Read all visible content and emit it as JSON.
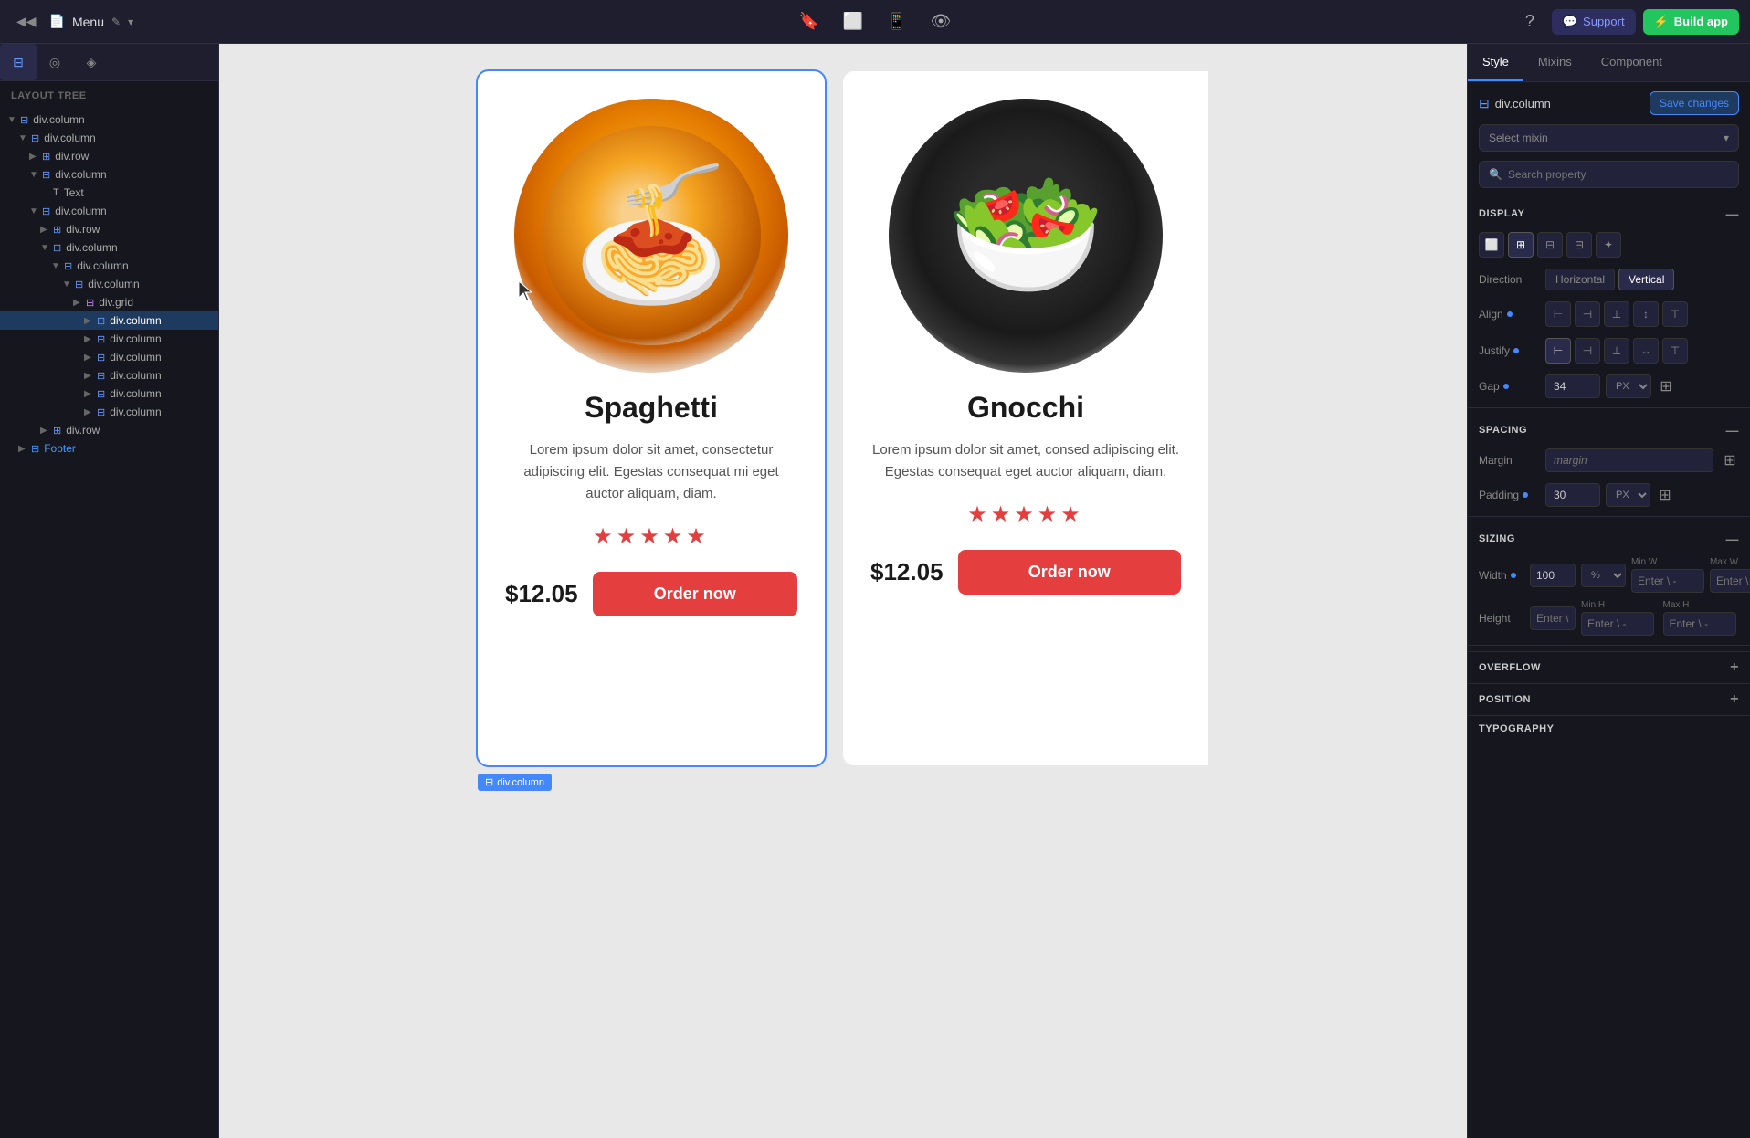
{
  "topbar": {
    "back_icon": "◀◀",
    "doc_title": "Menu",
    "edit_icon": "✎",
    "dropdown_icon": "▾",
    "center_icons": [
      "bookmark",
      "tablet",
      "phone",
      "eye"
    ],
    "support_label": "Support",
    "build_label": "Build app",
    "help_icon": "?"
  },
  "toolbar": {
    "tabs": [
      {
        "label": "layout-tree",
        "icon": "⊟",
        "active": true
      },
      {
        "label": "components",
        "icon": "◎",
        "active": false
      },
      {
        "label": "assets",
        "icon": "◈",
        "active": false
      }
    ]
  },
  "sidebar": {
    "header": "Layout Tree",
    "items": [
      {
        "id": "root-div-column",
        "label": "div.column",
        "depth": 0,
        "expanded": true,
        "type": "column"
      },
      {
        "id": "div-column-1",
        "label": "div.column",
        "depth": 1,
        "expanded": true,
        "type": "column"
      },
      {
        "id": "div-row-1",
        "label": "div.row",
        "depth": 2,
        "expanded": false,
        "type": "row"
      },
      {
        "id": "div-column-2",
        "label": "div.column",
        "depth": 2,
        "expanded": true,
        "type": "column"
      },
      {
        "id": "text-1",
        "label": "Text",
        "depth": 3,
        "expanded": false,
        "type": "text"
      },
      {
        "id": "div-column-3",
        "label": "div.column",
        "depth": 2,
        "expanded": true,
        "type": "column"
      },
      {
        "id": "div-row-2",
        "label": "div.row",
        "depth": 3,
        "expanded": false,
        "type": "row"
      },
      {
        "id": "div-column-4",
        "label": "div.column",
        "depth": 3,
        "expanded": true,
        "type": "column"
      },
      {
        "id": "div-column-5",
        "label": "div.column",
        "depth": 4,
        "expanded": true,
        "type": "column"
      },
      {
        "id": "div-column-6",
        "label": "div.column",
        "depth": 5,
        "expanded": true,
        "type": "column"
      },
      {
        "id": "div-grid-1",
        "label": "div.grid",
        "depth": 6,
        "expanded": false,
        "type": "grid"
      },
      {
        "id": "div-column-7",
        "label": "div.column",
        "depth": 7,
        "expanded": false,
        "type": "column",
        "selected": true
      },
      {
        "id": "div-column-8",
        "label": "div.column",
        "depth": 7,
        "expanded": false,
        "type": "column"
      },
      {
        "id": "div-column-9",
        "label": "div.column",
        "depth": 7,
        "expanded": false,
        "type": "column"
      },
      {
        "id": "div-column-10",
        "label": "div.column",
        "depth": 7,
        "expanded": false,
        "type": "column"
      },
      {
        "id": "div-column-11",
        "label": "div.column",
        "depth": 7,
        "expanded": false,
        "type": "column"
      },
      {
        "id": "div-column-12",
        "label": "div.column",
        "depth": 7,
        "expanded": false,
        "type": "column"
      },
      {
        "id": "div-row-3",
        "label": "div.row",
        "depth": 3,
        "expanded": false,
        "type": "row"
      },
      {
        "id": "footer",
        "label": "Footer",
        "depth": 1,
        "expanded": false,
        "type": "footer"
      }
    ]
  },
  "canvas": {
    "card1": {
      "title": "Spaghetti",
      "description": "Lorem ipsum dolor sit amet, consectetur adipiscing elit. Egestas consequat mi eget auctor aliquam, diam.",
      "stars": "★★★★★",
      "price": "$12.05",
      "order_btn": "Order now",
      "label": "div.column"
    },
    "card2": {
      "title": "Gnocchi",
      "description": "Lorem ipsum dolor sit amet, consed adipiscing elit. Egestas consequat eget auctor aliquam, diam.",
      "stars": "★★★★★",
      "price": "$12.05",
      "order_btn": "Order now"
    }
  },
  "right_panel": {
    "tabs": [
      "Style",
      "Mixins",
      "Component"
    ],
    "active_tab": "Style",
    "element_name": "div.column",
    "save_label": "Save changes",
    "mixin_placeholder": "Select mixin",
    "search_placeholder": "Search property",
    "sections": {
      "display": {
        "label": "DISPLAY",
        "layout_icons": [
          "block",
          "flex-h",
          "grid",
          "flex-v",
          "custom"
        ],
        "direction_label": "Direction",
        "horizontal_label": "Horizontal",
        "vertical_label": "Vertical",
        "align_label": "Align",
        "justify_label": "Justify",
        "gap_label": "Gap",
        "gap_value": "34",
        "gap_unit": "PX"
      },
      "spacing": {
        "label": "SPACING",
        "margin_label": "Margin",
        "margin_placeholder": "margin",
        "padding_label": "Padding",
        "padding_value": "30",
        "padding_unit": "PX"
      },
      "sizing": {
        "label": "SIZING",
        "width_label": "Width",
        "width_value": "100",
        "width_unit": "%",
        "min_w_label": "Min W",
        "min_w_placeholder": "Enter \\ -",
        "max_w_label": "Max W",
        "max_w_placeholder": "Enter \\ -",
        "height_label": "Height",
        "height_placeholder": "Enter \\ -",
        "min_h_label": "Min H",
        "min_h_placeholder": "Enter \\ -",
        "max_h_label": "Max H",
        "max_h_placeholder": "Enter \\ -"
      },
      "overflow": {
        "label": "OVERFLOW"
      },
      "position": {
        "label": "POSITION"
      },
      "typography": {
        "label": "TYPOGRAPHY"
      }
    }
  }
}
